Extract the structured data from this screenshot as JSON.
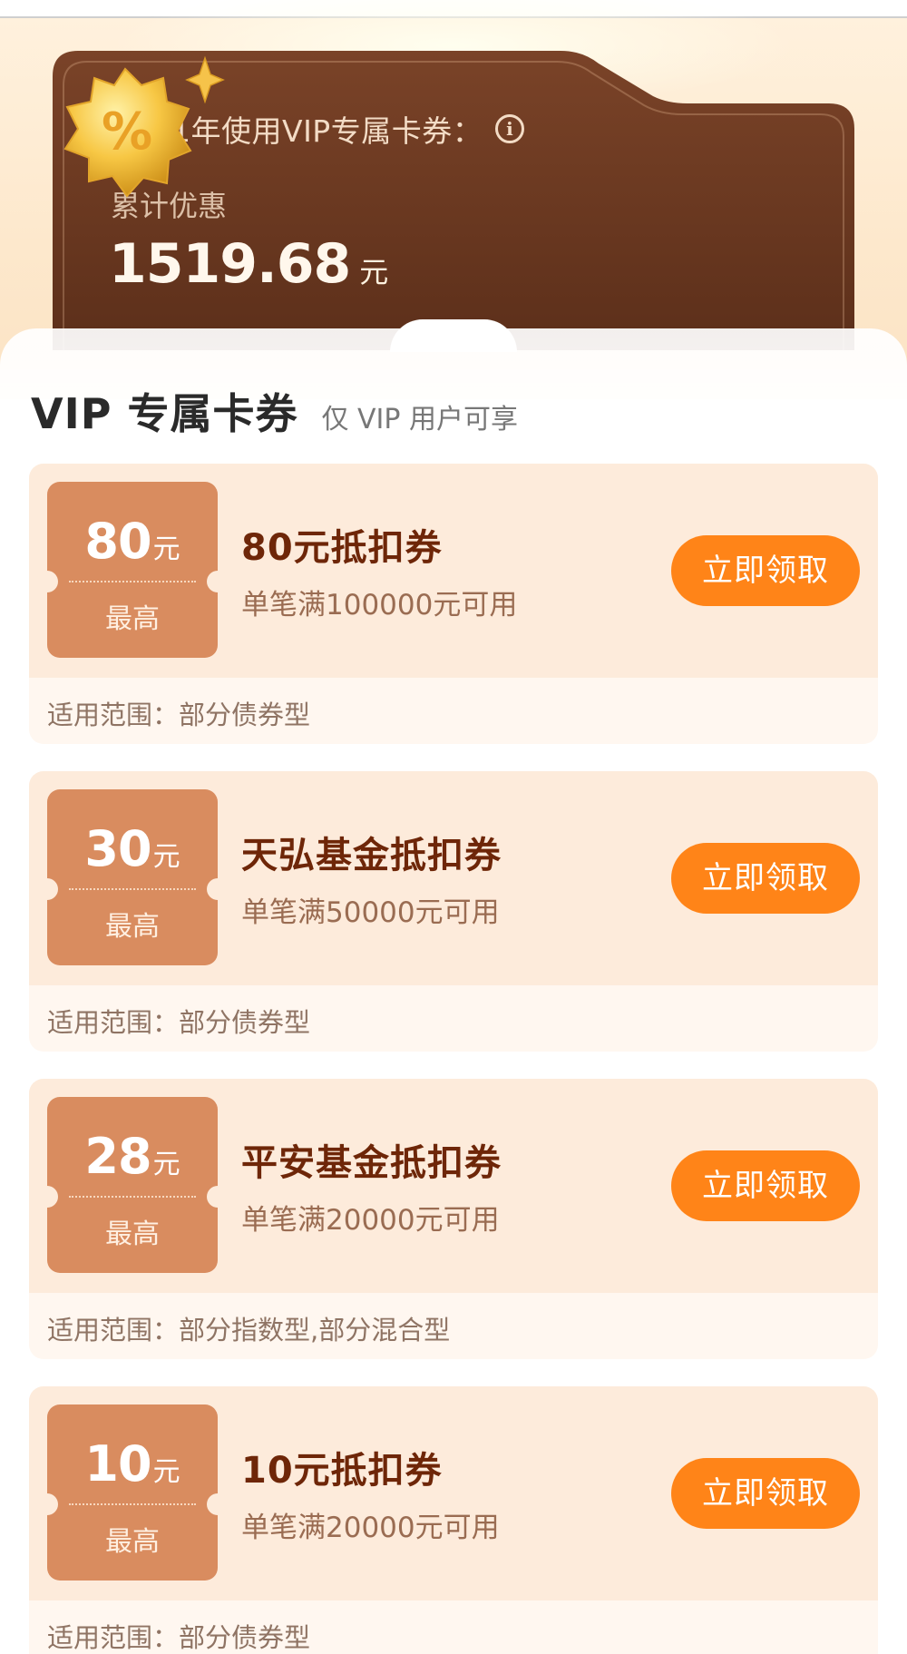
{
  "summary": {
    "title": "您近1年使用VIP专属卡券：",
    "info_icon": "i",
    "cumulative_label": "累计优惠",
    "cumulative_value": "1519.68",
    "cumulative_unit": "元",
    "badge_symbol": "%"
  },
  "section": {
    "title": "VIP 专属卡券",
    "subtitle": "仅 VIP 用户可享"
  },
  "coupons": [
    {
      "amount": "80",
      "unit": "元",
      "amount_label": "最高",
      "title": "80元抵扣券",
      "condition": "单笔满100000元可用",
      "button": "立即领取",
      "scope": "适用范围：部分债券型"
    },
    {
      "amount": "30",
      "unit": "元",
      "amount_label": "最高",
      "title": "天弘基金抵扣券",
      "condition": "单笔满50000元可用",
      "button": "立即领取",
      "scope": "适用范围：部分债券型"
    },
    {
      "amount": "28",
      "unit": "元",
      "amount_label": "最高",
      "title": "平安基金抵扣券",
      "condition": "单笔满20000元可用",
      "button": "立即领取",
      "scope": "适用范围：部分指数型,部分混合型"
    },
    {
      "amount": "10",
      "unit": "元",
      "amount_label": "最高",
      "title": "10元抵扣券",
      "condition": "单笔满20000元可用",
      "button": "立即领取",
      "scope": "适用范围：部分债券型"
    }
  ],
  "colors": {
    "card_brown": "#6b3a22",
    "stub": "#d98c5f",
    "button": "#ff8418",
    "coupon_bg": "#fdebdb"
  }
}
